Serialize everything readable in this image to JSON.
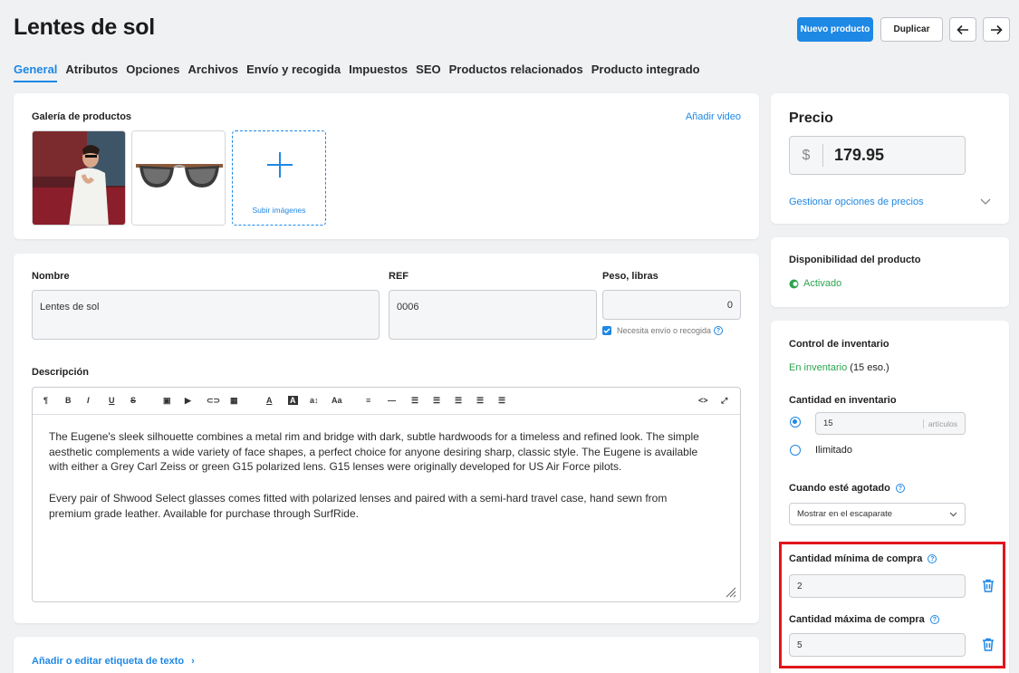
{
  "header": {
    "title": "Lentes de sol",
    "new_product": "Nuevo producto",
    "duplicate": "Duplicar",
    "prev_icon": "arrow-left-icon",
    "next_icon": "arrow-right-icon"
  },
  "tabs": [
    "General",
    "Atributos",
    "Opciones",
    "Archivos",
    "Envío y recogida",
    "Impuestos",
    "SEO",
    "Productos relacionados",
    "Producto integrado"
  ],
  "gallery": {
    "title": "Galería de productos",
    "add_video": "Añadir video",
    "upload_label": "Subir imágenes"
  },
  "details": {
    "name_label": "Nombre",
    "name_value": "Lentes de sol",
    "ref_label": "REF",
    "ref_value": "0006",
    "weight_label": "Peso, libras",
    "weight_value": "0",
    "shipping_check": "Necesita envío o recogida",
    "description_label": "Descripción",
    "description_p1": "The Eugene's sleek silhouette combines a metal rim and bridge with dark, subtle hardwoods for a timeless and refined look. The simple aesthetic complements a wide variety of face shapes, a perfect choice for anyone desiring sharp, classic style. The Eugene is available with either a Grey Carl Zeiss or green G15 polarized lens. G15 lenses were originally developed for US Air Force pilots.",
    "description_p2": "Every pair of Shwood Select glasses comes fitted with polarized lenses and paired with a semi-hard travel case, hand sewn from premium grade leather. Available for purchase through SurfRide."
  },
  "toolbar": {
    "items": [
      "¶",
      "B",
      "I",
      "U",
      "S",
      "▣",
      "▶",
      "⊂⊃",
      "▦",
      "A",
      "A",
      "a↕",
      "Aa",
      "≡",
      "—",
      "☰",
      "☰",
      "☰",
      "☰",
      "☰"
    ],
    "code": "<>",
    "expand": "⤢"
  },
  "text_tag": {
    "link": "Añadir o editar etiqueta de texto"
  },
  "price": {
    "title": "Precio",
    "currency": "$",
    "value": "179.95",
    "manage": "Gestionar opciones de precios"
  },
  "availability": {
    "title": "Disponibilidad del producto",
    "status": "Activado"
  },
  "inventory": {
    "title": "Control de inventario",
    "in_stock": "En inventario",
    "in_stock_count": "(15 eso.)",
    "qty_label": "Cantidad en inventario",
    "qty_value": "15",
    "qty_unit": "artículos",
    "unlimited": "Ilimitado",
    "out_of_stock_label": "Cuando esté agotado",
    "out_of_stock_value": "Mostrar en el escaparate",
    "min_label": "Cantidad mínima de compra",
    "min_value": "2",
    "max_label": "Cantidad máxima de compra",
    "max_value": "5"
  },
  "colors": {
    "accent": "#1e88e5",
    "success": "#2ea44f",
    "highlight": "#e0161b"
  }
}
